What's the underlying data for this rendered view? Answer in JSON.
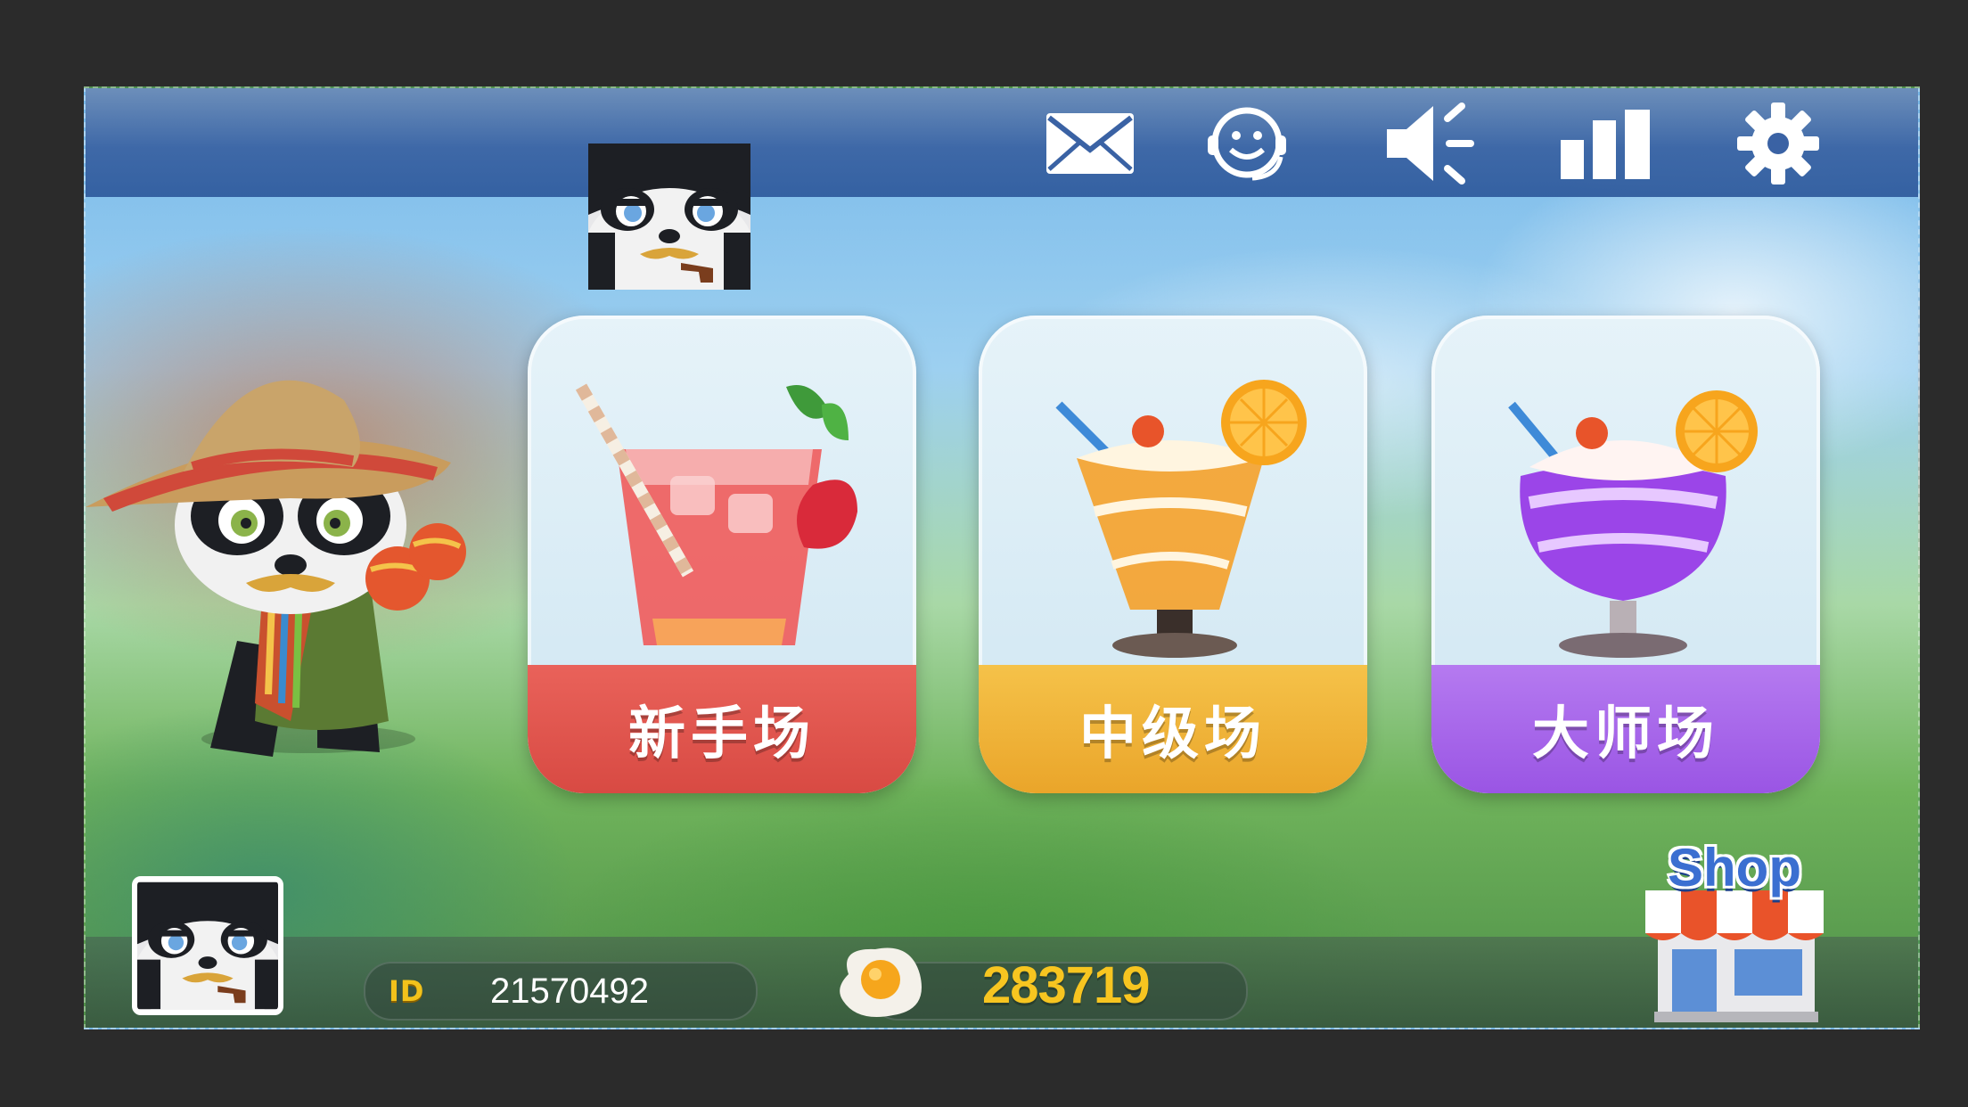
{
  "top_bar": {
    "icons": [
      "mail-icon",
      "customer-service-icon",
      "sound-icon",
      "leaderboard-icon",
      "settings-icon"
    ]
  },
  "rooms": [
    {
      "label": "新手场",
      "color": "#e25a52",
      "drink": "strawberry-iced-drink"
    },
    {
      "label": "中级场",
      "color": "#f0b63a",
      "drink": "orange-parfait"
    },
    {
      "label": "大师场",
      "color": "#a866ea",
      "drink": "purple-sundae"
    }
  ],
  "player": {
    "id_badge": "ID",
    "id": "21570492",
    "coins": "283719"
  },
  "shop": {
    "label": "Shop"
  },
  "colors": {
    "top_bar": "#3a62a4",
    "coin_text": "#f7c520",
    "id_badge": "#f2c21b"
  }
}
